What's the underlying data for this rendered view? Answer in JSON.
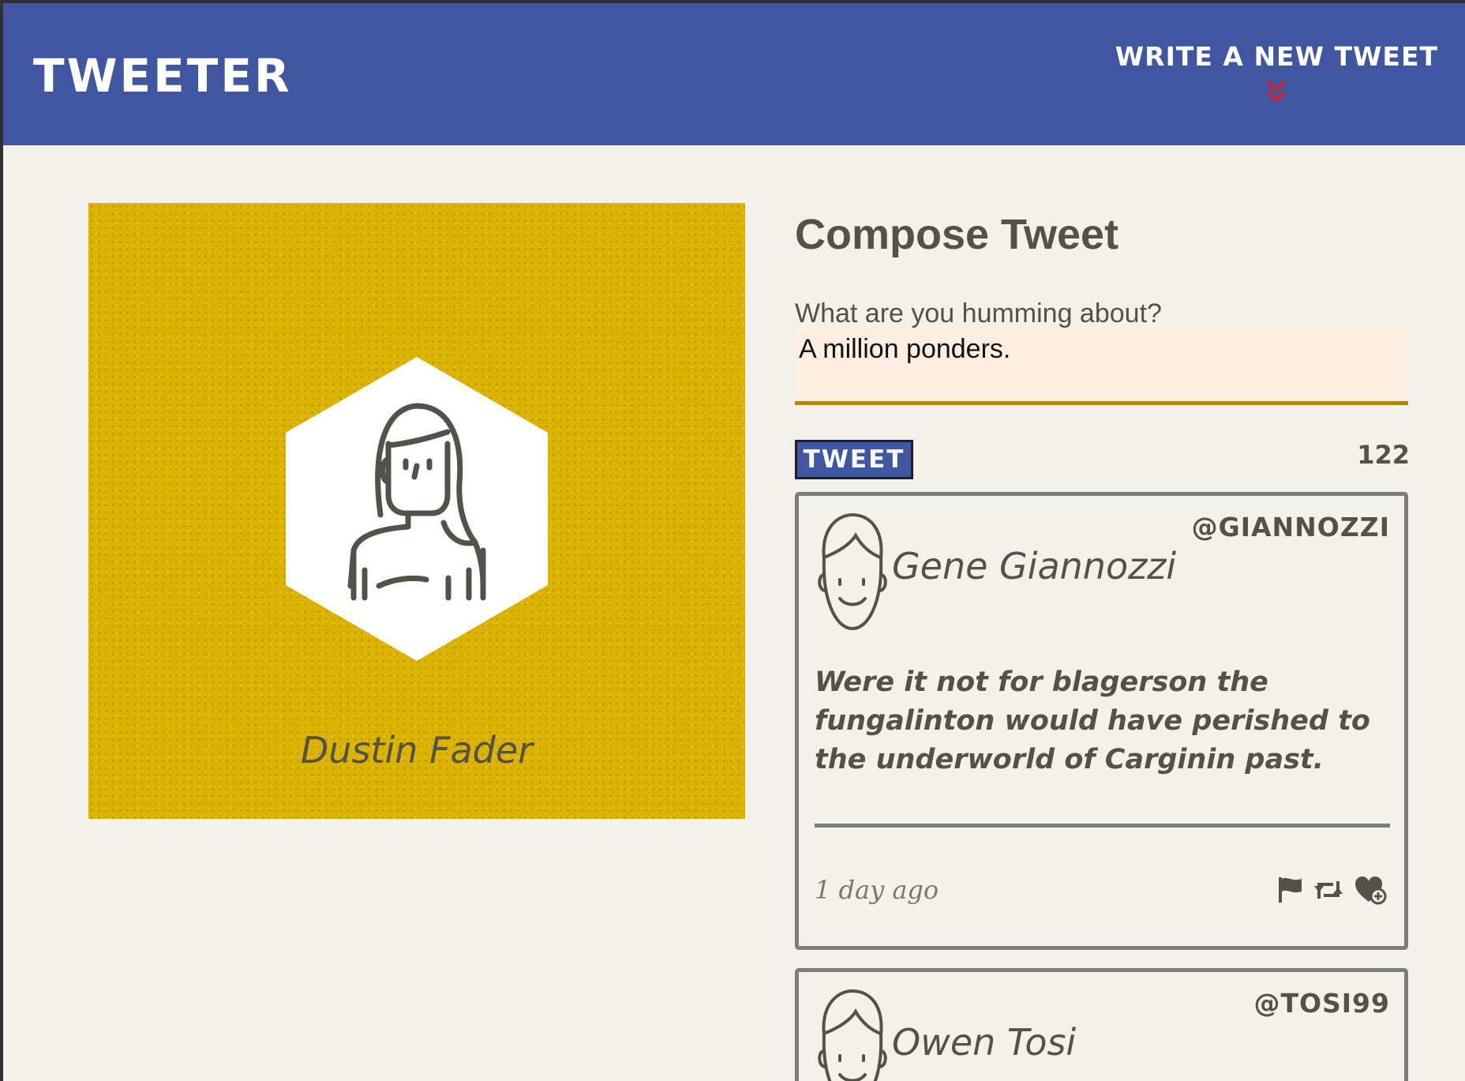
{
  "navbar": {
    "brand": "TWEETER",
    "write_new_label": "WRITE A NEW TWEET",
    "bg_color": "#4056a1",
    "arrow_color": "#d21f2c"
  },
  "profile": {
    "name": "Dustin Fader",
    "avatar_icon": "woman-avatar-icon",
    "bg_color": "#dcb400"
  },
  "compose": {
    "title": "Compose Tweet",
    "prompt_label": "What are you humming about?",
    "input_value": "A million ponders.",
    "button_label": "TWEET",
    "char_count": "122"
  },
  "tweets": [
    {
      "name": "Gene Giannozzi",
      "handle": "@GIANNOZZI",
      "avatar_icon": "man-avatar-icon",
      "text": "Were it not for blagerson the fungalinton would have perished to the underworld of Carginin past.",
      "time": "1 day ago",
      "actions": [
        "flag-icon",
        "retweet-icon",
        "like-icon"
      ]
    },
    {
      "name": "Owen Tosi",
      "handle": "@TOSI99",
      "avatar_icon": "man-avatar-icon"
    }
  ]
}
